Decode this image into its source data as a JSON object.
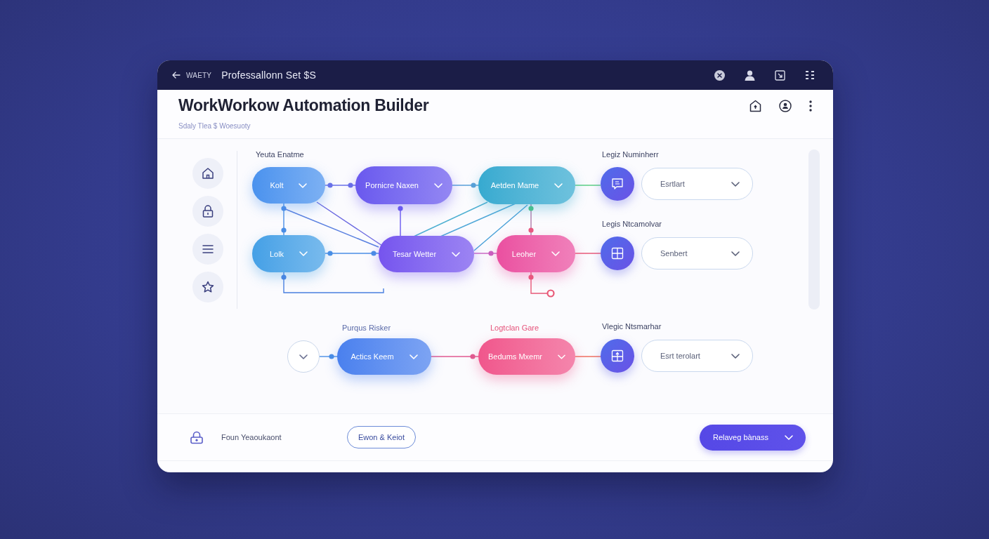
{
  "top_bar": {
    "back_label": "WAETY",
    "title": "Professallonn Set $S"
  },
  "header": {
    "title": "WorkWorkow Automation Builder",
    "subtitle": "Sdaly Tlea $ Woesuoty"
  },
  "canvas": {
    "labels": [
      {
        "text": "Yeuta Enatme",
        "color": "#3c4262"
      },
      {
        "text": "Purqus Risker",
        "color": "#5a6aa8"
      },
      {
        "text": "Logtclan Gare",
        "color": "#e5527a"
      }
    ],
    "nodes": [
      {
        "label": "Kolt",
        "color": "#4a92ee"
      },
      {
        "label": "Pornicre Naxen",
        "color": "#6a58ee"
      },
      {
        "label": "Aetden Mame",
        "color": "#36aad0"
      },
      {
        "label": "Lolk",
        "color": "#44a0e6"
      },
      {
        "label": "Tesar Wetter",
        "color": "#7654ee"
      },
      {
        "label": "Leoher",
        "color": "#ea4fa0"
      },
      {
        "label": "Actics Keem",
        "color": "#4a80ee"
      },
      {
        "label": "Bedums Mxemr",
        "color": "#f0568c"
      }
    ],
    "outputs": [
      {
        "label": "Legiz Numinherr",
        "value": "Esrtlart"
      },
      {
        "label": "Legis Ntcamolvar",
        "value": "Senbert"
      },
      {
        "label": "Vlegic Ntsmarhar",
        "value": "Esrt terolart"
      }
    ]
  },
  "footer": {
    "status_text": "Foun Yeaoukaont",
    "secondary_button": "Ewon & Keiot",
    "primary_button": "Relaveg bànass"
  }
}
